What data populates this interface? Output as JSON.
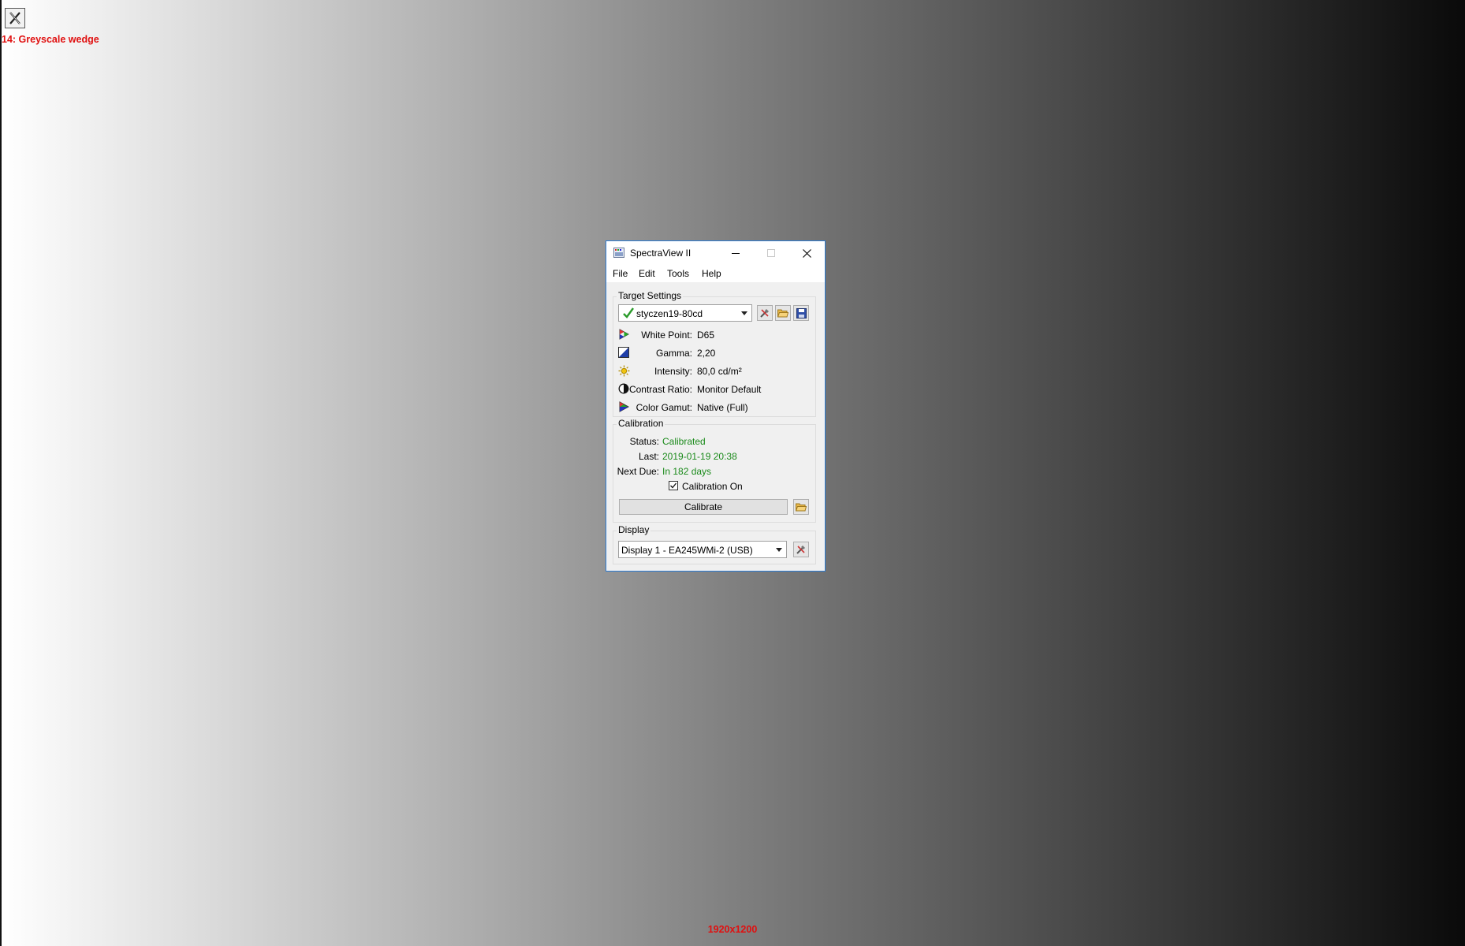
{
  "overlay": {
    "title": "14: Greyscale wedge",
    "resolution": "1920x1200"
  },
  "window": {
    "title": "SpectraView II"
  },
  "menu": [
    "File",
    "Edit",
    "Tools",
    "Help"
  ],
  "target_settings": {
    "group_title": "Target Settings",
    "profile": "styczen19-80cd",
    "rows": [
      {
        "label": "White Point:",
        "value": "D65",
        "icon": "white-point-icon"
      },
      {
        "label": "Gamma:",
        "value": "2,20",
        "icon": "gamma-icon"
      },
      {
        "label": "Intensity:",
        "value": "80,0 cd/m²",
        "icon": "intensity-sun-icon"
      },
      {
        "label": "Contrast Ratio:",
        "value": "Monitor Default",
        "icon": "contrast-icon"
      },
      {
        "label": "Color Gamut:",
        "value": "Native (Full)",
        "icon": "color-gamut-icon"
      }
    ]
  },
  "calibration": {
    "group_title": "Calibration",
    "status_label": "Status:",
    "status_value": "Calibrated",
    "last_label": "Last:",
    "last_value": "2019-01-19 20:38",
    "next_label": "Next Due:",
    "next_value": "In 182 days",
    "checkbox_label": "Calibration On",
    "checkbox_checked": true,
    "button_label": "Calibrate",
    "status_color": "#1a8a1a"
  },
  "display": {
    "group_title": "Display",
    "selected": "Display 1 - EA245WMi-2 (USB)"
  }
}
